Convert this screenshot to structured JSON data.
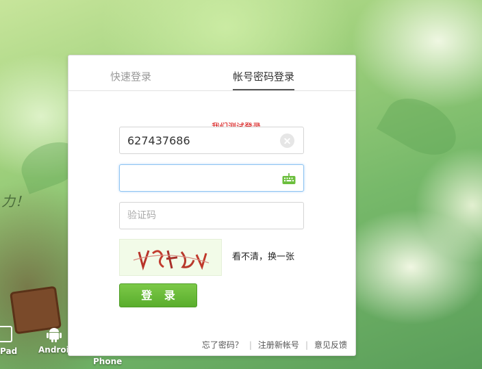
{
  "background": {
    "brush_text": "力！"
  },
  "platforms": {
    "pad": "Pad",
    "android": "Android",
    "phone": "Phone"
  },
  "tabs": {
    "quick_login": "快速登录",
    "account_login": "帐号密码登录"
  },
  "test_label": "我们测试登录",
  "form": {
    "username_value": "627437686",
    "password_value": "",
    "captcha_placeholder": "验证码",
    "refresh_link": "看不清，换一张",
    "login_button": "登 录"
  },
  "footer": {
    "forgot_password": "忘了密码？",
    "register": "注册新帐号",
    "feedback": "意见反馈"
  },
  "colors": {
    "accent_green": "#59ad2c",
    "test_label_red": "#d40000",
    "focus_blue": "#8dc4f2"
  }
}
